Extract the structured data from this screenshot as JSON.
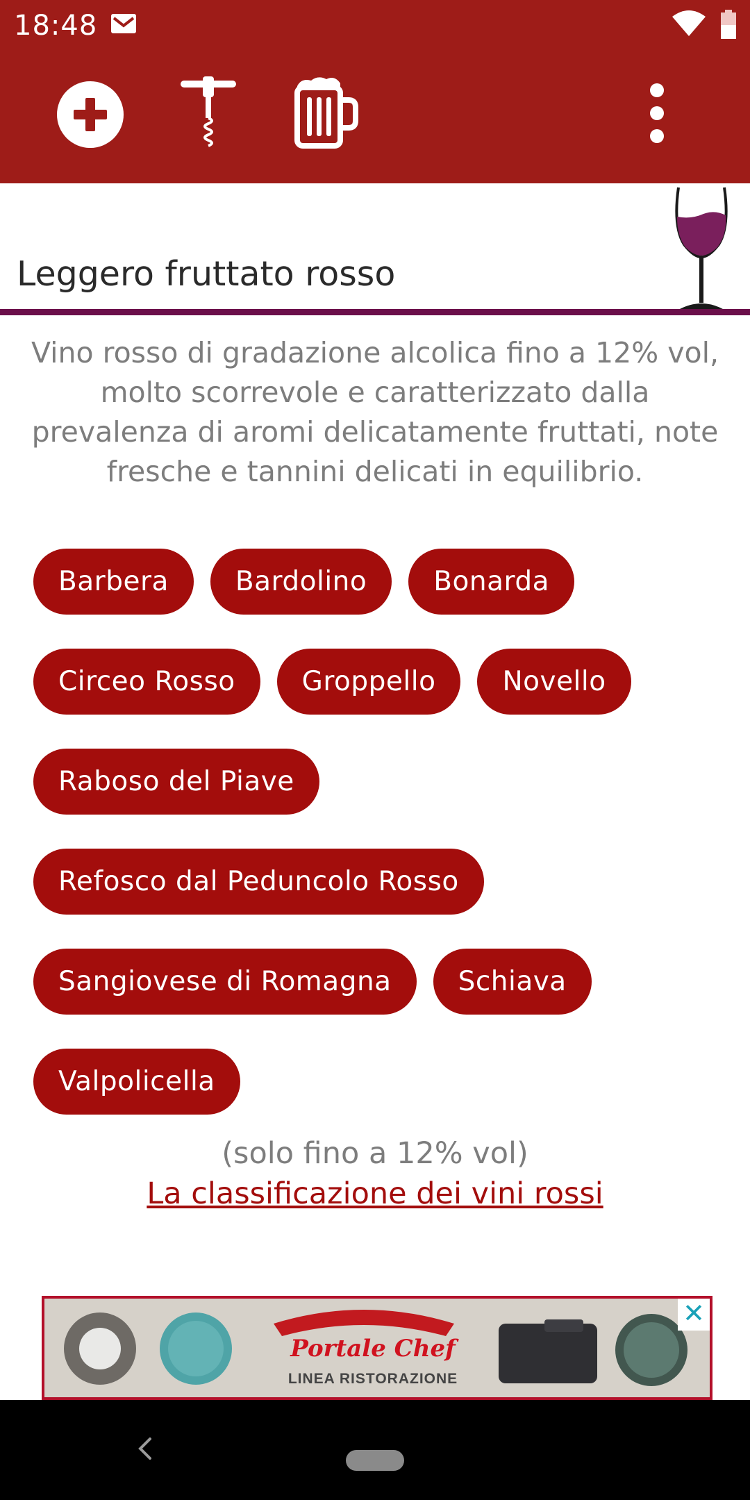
{
  "status_bar": {
    "time": "18:48"
  },
  "toolbar": {
    "add_icon": "add-circle-icon",
    "corkscrew_icon": "corkscrew-icon",
    "beer_icon": "beer-mug-icon",
    "menu_icon": "more-vertical-icon",
    "bg_color": "#9e1c18"
  },
  "category": {
    "title": "Leggero fruttato rosso",
    "icon": "wine-glass-icon",
    "accent": "#6b0f4a"
  },
  "description": "Vino rosso di gradazione alcolica fino a 12% vol, molto scorrevole e caratterizzato dalla prevalenza di aromi delicatamente fruttati, note fresche e tannini delicati in equilibrio.",
  "wines": [
    [
      "Barbera",
      "Bardolino",
      "Bonarda"
    ],
    [
      "Circeo Rosso",
      "Groppello",
      "Novello"
    ],
    [
      "Raboso del Piave"
    ],
    [
      "Refosco dal Peduncolo Rosso"
    ],
    [
      "Sangiovese di Romagna",
      "Schiava"
    ],
    [
      "Valpolicella"
    ]
  ],
  "chip_color": "#a30d0c",
  "note": "(solo fino a 12% vol)",
  "classification_link": "La classificazione dei vini rossi",
  "ad": {
    "brand": "Portale Chef",
    "tagline": "LINEA RISTORAZIONE",
    "close": "✕"
  }
}
